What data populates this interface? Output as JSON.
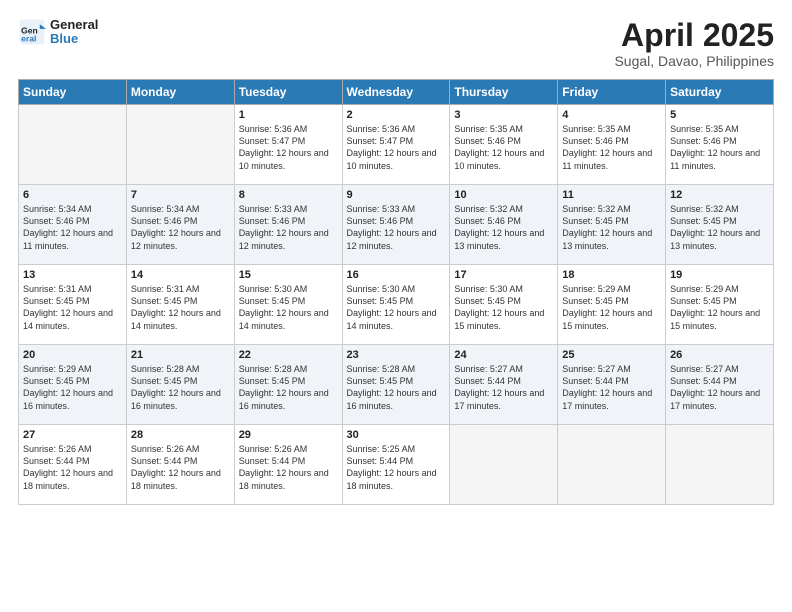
{
  "logo": {
    "line1": "General",
    "line2": "Blue"
  },
  "title": "April 2025",
  "subtitle": "Sugal, Davao, Philippines",
  "weekdays": [
    "Sunday",
    "Monday",
    "Tuesday",
    "Wednesday",
    "Thursday",
    "Friday",
    "Saturday"
  ],
  "weeks": [
    [
      {
        "day": "",
        "info": ""
      },
      {
        "day": "",
        "info": ""
      },
      {
        "day": "1",
        "info": "Sunrise: 5:36 AM\nSunset: 5:47 PM\nDaylight: 12 hours and 10 minutes."
      },
      {
        "day": "2",
        "info": "Sunrise: 5:36 AM\nSunset: 5:47 PM\nDaylight: 12 hours and 10 minutes."
      },
      {
        "day": "3",
        "info": "Sunrise: 5:35 AM\nSunset: 5:46 PM\nDaylight: 12 hours and 10 minutes."
      },
      {
        "day": "4",
        "info": "Sunrise: 5:35 AM\nSunset: 5:46 PM\nDaylight: 12 hours and 11 minutes."
      },
      {
        "day": "5",
        "info": "Sunrise: 5:35 AM\nSunset: 5:46 PM\nDaylight: 12 hours and 11 minutes."
      }
    ],
    [
      {
        "day": "6",
        "info": "Sunrise: 5:34 AM\nSunset: 5:46 PM\nDaylight: 12 hours and 11 minutes."
      },
      {
        "day": "7",
        "info": "Sunrise: 5:34 AM\nSunset: 5:46 PM\nDaylight: 12 hours and 12 minutes."
      },
      {
        "day": "8",
        "info": "Sunrise: 5:33 AM\nSunset: 5:46 PM\nDaylight: 12 hours and 12 minutes."
      },
      {
        "day": "9",
        "info": "Sunrise: 5:33 AM\nSunset: 5:46 PM\nDaylight: 12 hours and 12 minutes."
      },
      {
        "day": "10",
        "info": "Sunrise: 5:32 AM\nSunset: 5:46 PM\nDaylight: 12 hours and 13 minutes."
      },
      {
        "day": "11",
        "info": "Sunrise: 5:32 AM\nSunset: 5:45 PM\nDaylight: 12 hours and 13 minutes."
      },
      {
        "day": "12",
        "info": "Sunrise: 5:32 AM\nSunset: 5:45 PM\nDaylight: 12 hours and 13 minutes."
      }
    ],
    [
      {
        "day": "13",
        "info": "Sunrise: 5:31 AM\nSunset: 5:45 PM\nDaylight: 12 hours and 14 minutes."
      },
      {
        "day": "14",
        "info": "Sunrise: 5:31 AM\nSunset: 5:45 PM\nDaylight: 12 hours and 14 minutes."
      },
      {
        "day": "15",
        "info": "Sunrise: 5:30 AM\nSunset: 5:45 PM\nDaylight: 12 hours and 14 minutes."
      },
      {
        "day": "16",
        "info": "Sunrise: 5:30 AM\nSunset: 5:45 PM\nDaylight: 12 hours and 14 minutes."
      },
      {
        "day": "17",
        "info": "Sunrise: 5:30 AM\nSunset: 5:45 PM\nDaylight: 12 hours and 15 minutes."
      },
      {
        "day": "18",
        "info": "Sunrise: 5:29 AM\nSunset: 5:45 PM\nDaylight: 12 hours and 15 minutes."
      },
      {
        "day": "19",
        "info": "Sunrise: 5:29 AM\nSunset: 5:45 PM\nDaylight: 12 hours and 15 minutes."
      }
    ],
    [
      {
        "day": "20",
        "info": "Sunrise: 5:29 AM\nSunset: 5:45 PM\nDaylight: 12 hours and 16 minutes."
      },
      {
        "day": "21",
        "info": "Sunrise: 5:28 AM\nSunset: 5:45 PM\nDaylight: 12 hours and 16 minutes."
      },
      {
        "day": "22",
        "info": "Sunrise: 5:28 AM\nSunset: 5:45 PM\nDaylight: 12 hours and 16 minutes."
      },
      {
        "day": "23",
        "info": "Sunrise: 5:28 AM\nSunset: 5:45 PM\nDaylight: 12 hours and 16 minutes."
      },
      {
        "day": "24",
        "info": "Sunrise: 5:27 AM\nSunset: 5:44 PM\nDaylight: 12 hours and 17 minutes."
      },
      {
        "day": "25",
        "info": "Sunrise: 5:27 AM\nSunset: 5:44 PM\nDaylight: 12 hours and 17 minutes."
      },
      {
        "day": "26",
        "info": "Sunrise: 5:27 AM\nSunset: 5:44 PM\nDaylight: 12 hours and 17 minutes."
      }
    ],
    [
      {
        "day": "27",
        "info": "Sunrise: 5:26 AM\nSunset: 5:44 PM\nDaylight: 12 hours and 18 minutes."
      },
      {
        "day": "28",
        "info": "Sunrise: 5:26 AM\nSunset: 5:44 PM\nDaylight: 12 hours and 18 minutes."
      },
      {
        "day": "29",
        "info": "Sunrise: 5:26 AM\nSunset: 5:44 PM\nDaylight: 12 hours and 18 minutes."
      },
      {
        "day": "30",
        "info": "Sunrise: 5:25 AM\nSunset: 5:44 PM\nDaylight: 12 hours and 18 minutes."
      },
      {
        "day": "",
        "info": ""
      },
      {
        "day": "",
        "info": ""
      },
      {
        "day": "",
        "info": ""
      }
    ]
  ]
}
